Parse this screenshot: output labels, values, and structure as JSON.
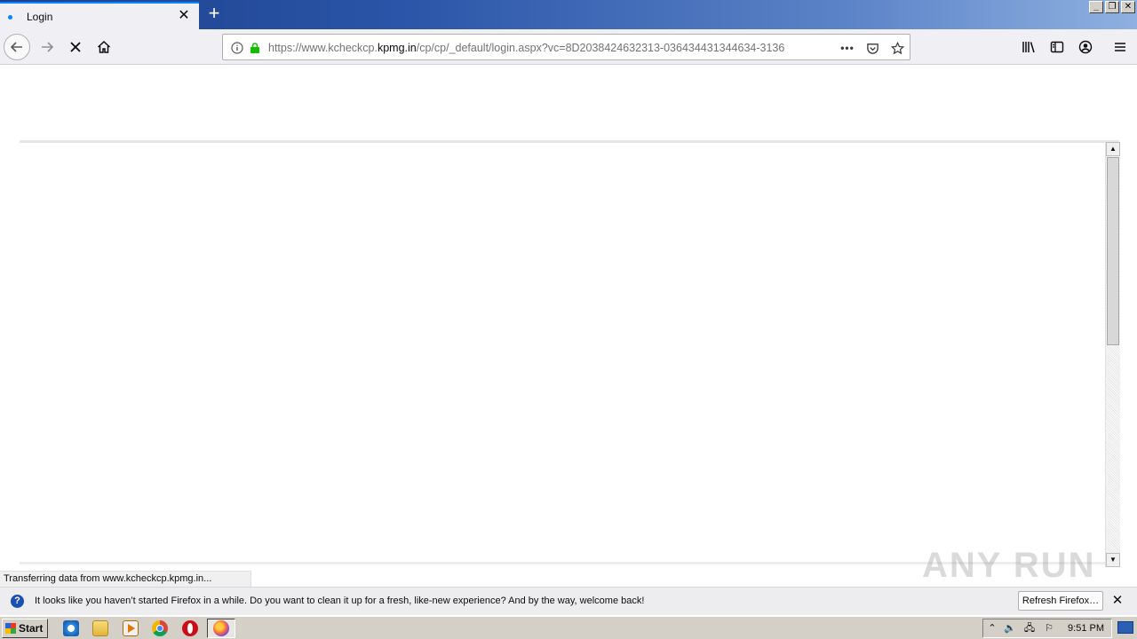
{
  "tab": {
    "title": "Login"
  },
  "urlbar": {
    "url_prefix": "https://www.kcheckcp.",
    "url_host": "kpmg.in",
    "url_suffix": "/cp/cp/_default/login.aspx?vc=8D2038424632313-036434431344634-3136"
  },
  "status": {
    "text": "Transferring data from www.kcheckcp.kpmg.in..."
  },
  "notification": {
    "message": "It looks like you haven’t started Firefox in a while. Do you want to clean it up for a fresh, like-new experience? And by the way, welcome back!",
    "button_label": "Refresh Firefox…"
  },
  "taskbar": {
    "start_label": "Start",
    "clock": "9:51 PM"
  },
  "watermark": {
    "text": "ANY RUN"
  },
  "colors": {
    "accent": "#0a84ff",
    "secure": "#12bc00",
    "titlebar": "#2a55a8"
  }
}
